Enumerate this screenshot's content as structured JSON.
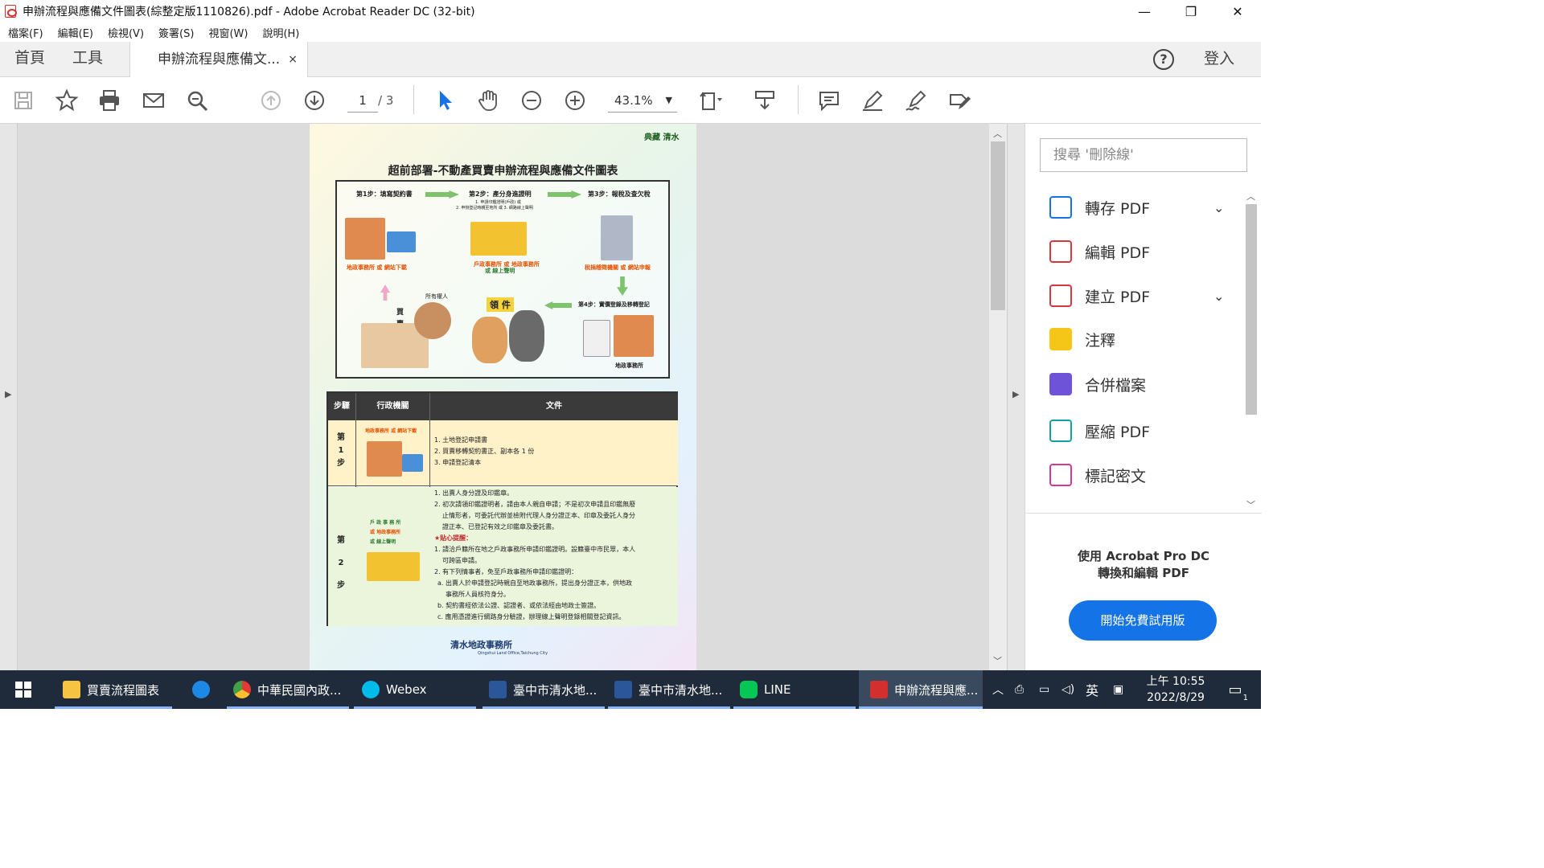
{
  "window": {
    "title": "申辦流程與應備文件圖表(綜整定版1110826).pdf - Adobe Acrobat Reader DC (32-bit)",
    "minimize": "—",
    "restore": "❐",
    "close": "✕"
  },
  "menu": [
    "檔案(F)",
    "編輯(E)",
    "檢視(V)",
    "簽署(S)",
    "視窗(W)",
    "說明(H)"
  ],
  "tabs": {
    "home": "首頁",
    "tools": "工具",
    "document": "申辦流程與應備文...",
    "close": "×",
    "help": "?",
    "login": "登入"
  },
  "toolbar": {
    "page_current": "1",
    "page_total": "/ 3",
    "zoom": "43.1%"
  },
  "pdf": {
    "logo": "典藏 清水",
    "title": "超前部署-不動產買賣申辦流程與應備文件圖表",
    "step1": "第1步：填寫契約書",
    "step2": "第2步：產分身進證明",
    "step2_sub1": "1. 申請印鑑證明(戶政) 或",
    "step2_sub2": "2. 申辦登記時親至地所 或 3. 網路線上聲明",
    "step3": "第3步：報稅及查欠稅",
    "step4": "第4步：實價登錄及移轉登記",
    "lbl_step1": "地政事務所 或 網站下載",
    "lbl_step2a": "戶政事務所 或 地政事務所",
    "lbl_step2b": "或 線上聲明",
    "lbl_step3": "稅捐稽徵機關 或 網站申報",
    "owner": "所有權人",
    "buy": "買",
    "sell": "賣",
    "pickup": "領 件",
    "land_office": "地政事務所",
    "table_head": [
      "步驟",
      "行政機關",
      "文件"
    ],
    "row1_step": "第 1 步",
    "row1_docs": [
      "1. 土地登記申請書",
      "2. 買賣移轉契約書正、副本各 1 份",
      "3. 申請登記清本"
    ],
    "row1_agency": "地政事務所 或 網站下載",
    "row2_step": "第 2 步",
    "row2_agency": [
      "戶 政 事 務 所",
      "或 地政事務所",
      "或 線上聲明"
    ],
    "row2_docs": [
      "1. 出賣人身分證及印鑑章。",
      "2. 初次請領印鑑證明者，請由本人親自申請；不是初次申請且印鑑無廢",
      "止情形者，可委託代辦並檢附代理人身分證正本、印章及委託人身分",
      "證正本、已登記有效之印鑑章及委託書。",
      "★貼心提醒：",
      "1. 請洽戶籍所在地之戶政事務所申請印鑑證明。設籍臺中市民眾，本人",
      "可跨區申請。",
      "2. 有下列情事者，免至戶政事務所申請印鑑證明：",
      "a. 出賣人於申請登記時親自至地政事務所，提出身分證正本，供地政",
      "事務所人員核符身分。",
      "b. 契約書經依法公證、認證者、或依法經由地政士簽證。",
      "c. 應用憑證進行網路身分驗證，辦理線上聲明登錄相關登記資訊。"
    ],
    "footer": "清水地政事務所",
    "footer_en": "Qingshui Land Office,Taichung City"
  },
  "pane": {
    "search_placeholder": "搜尋 '刪除線'",
    "tools": [
      {
        "label": "轉存 PDF",
        "icon": "export-pdf-icon",
        "color": "#1473e6",
        "chevron": true
      },
      {
        "label": "編輯 PDF",
        "icon": "edit-pdf-icon",
        "color": "#d7373f",
        "chevron": false
      },
      {
        "label": "建立 PDF",
        "icon": "create-pdf-icon",
        "color": "#d7373f",
        "chevron": true
      },
      {
        "label": "注釋",
        "icon": "comment-icon",
        "color": "#e8b000",
        "chevron": false
      },
      {
        "label": "合併檔案",
        "icon": "combine-files-icon",
        "color": "#6e52d8",
        "chevron": false
      },
      {
        "label": "壓縮 PDF",
        "icon": "compress-pdf-icon",
        "color": "#15a0a0",
        "chevron": false
      },
      {
        "label": "標記密文",
        "icon": "redact-icon",
        "color": "#d83790",
        "chevron": false
      }
    ],
    "promo_line1": "使用 Acrobat Pro DC",
    "promo_line2": "轉換和編輯 PDF",
    "trial_button": "開始免費試用版"
  },
  "taskbar": {
    "items": [
      {
        "label": "買賣流程圖表",
        "icon": "folder-icon",
        "color": "#f6c343"
      },
      {
        "label": "",
        "icon": "ie-icon",
        "color": "#1e88e5"
      },
      {
        "label": "中華民國內政...",
        "icon": "chrome-icon",
        "color": "#e53935"
      },
      {
        "label": "Webex",
        "icon": "webex-icon",
        "color": "#00bceb"
      },
      {
        "label": "臺中市清水地...",
        "icon": "word-icon",
        "color": "#2b579a"
      },
      {
        "label": "臺中市清水地...",
        "icon": "word-icon",
        "color": "#2b579a"
      },
      {
        "label": "LINE",
        "icon": "line-icon",
        "color": "#06c755"
      },
      {
        "label": "申辦流程與應...",
        "icon": "acrobat-icon",
        "color": "#d32f2f"
      }
    ],
    "ime": "英",
    "time": "上午 10:55",
    "date": "2022/8/29",
    "notifications": "1"
  }
}
